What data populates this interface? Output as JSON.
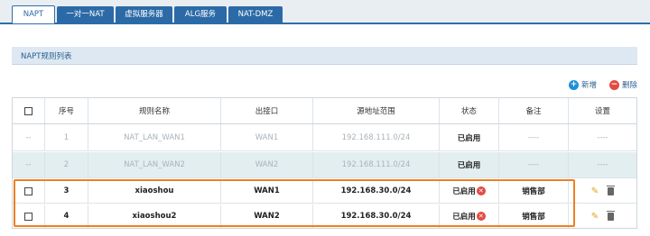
{
  "tabs": [
    {
      "label": "NAPT",
      "active": true
    },
    {
      "label": "一对一NAT",
      "active": false
    },
    {
      "label": "虚拟服务器",
      "active": false
    },
    {
      "label": "ALG服务",
      "active": false
    },
    {
      "label": "NAT-DMZ",
      "active": false
    }
  ],
  "section_title": "NAPT规则列表",
  "actions": {
    "add_label": "新增",
    "delete_label": "删除"
  },
  "columns": [
    "序号",
    "规则名称",
    "出接口",
    "源地址范围",
    "状态",
    "备注",
    "设置"
  ],
  "rows": [
    {
      "select": "--",
      "index": "1",
      "name": "NAT_LAN_WAN1",
      "interface": "WAN1",
      "source": "192.168.111.0/24",
      "status": "已启用",
      "note": "----",
      "settings": "----",
      "disabled": true,
      "tinted": false
    },
    {
      "select": "--",
      "index": "2",
      "name": "NAT_LAN_WAN2",
      "interface": "WAN2",
      "source": "192.168.111.0/24",
      "status": "已启用",
      "note": "----",
      "settings": "----",
      "disabled": true,
      "tinted": true
    },
    {
      "index": "3",
      "name": "xiaoshou",
      "interface": "WAN1",
      "source": "192.168.30.0/24",
      "status": "已启用",
      "note": "销售部",
      "disabled": false,
      "tinted": false
    },
    {
      "index": "4",
      "name": "xiaoshou2",
      "interface": "WAN2",
      "source": "192.168.30.0/24",
      "status": "已启用",
      "note": "销售部",
      "disabled": false,
      "tinted": false
    }
  ],
  "icons": {
    "add": "plus-circle-icon",
    "delete": "minus-circle-icon",
    "edit": "pencil-icon",
    "remove": "trash-icon",
    "status_disable": "x-circle-icon"
  },
  "colors": {
    "tab_blue": "#2b6aa6",
    "highlight": "#ef7f22",
    "status_x": "#e24b43",
    "edit_pencil": "#e5a21b"
  }
}
